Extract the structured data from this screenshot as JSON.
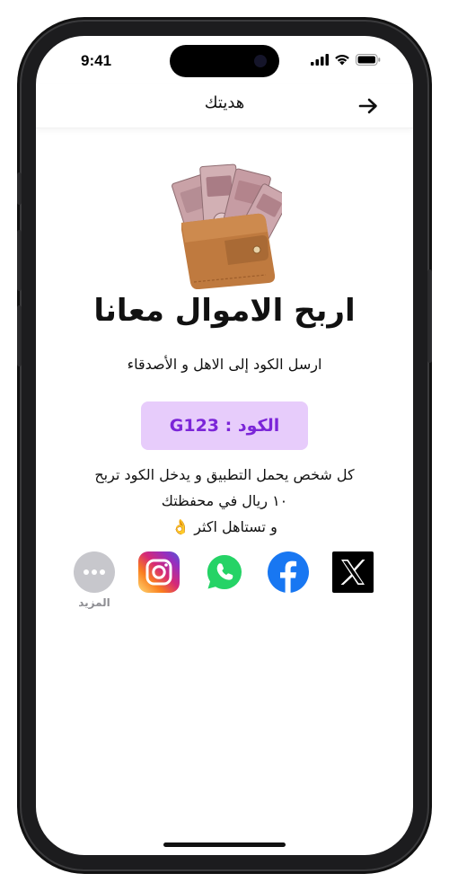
{
  "status_bar": {
    "time": "9:41"
  },
  "header": {
    "title": "هديتك"
  },
  "hero": {
    "image": "wallet-with-money-image"
  },
  "headline": "اربح الاموال معانا",
  "subtitle": "ارسل الكود  إلى الاهل و الأصدقاء",
  "code_box": {
    "label": "الكود : G123"
  },
  "description": {
    "line1": "كل شخص  يحمل التطبيق و يدخل الكود تربح",
    "line2": "١٠ ريال  في محفظتك",
    "line3": "و تستاهل اكثر 👌"
  },
  "share": {
    "more_label": "المزيد",
    "items": [
      "more-icon",
      "instagram-icon",
      "whatsapp-icon",
      "facebook-icon",
      "x-icon"
    ]
  },
  "colors": {
    "code_bg": "#e7ccfb",
    "code_text": "#7b25d8",
    "facebook": "#1877f2",
    "whatsapp": "#25d366"
  }
}
